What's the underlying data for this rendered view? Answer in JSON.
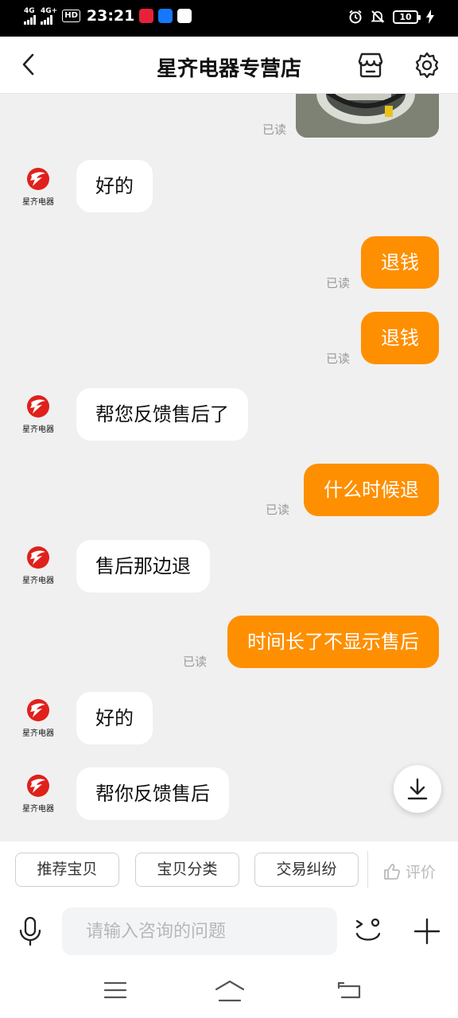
{
  "status_bar": {
    "signal1": "4G",
    "signal2": "4G+",
    "hd": "HD",
    "time": "23:21",
    "battery": "10"
  },
  "header": {
    "title": "星齐电器专营店"
  },
  "shop": {
    "avatar_label": "星齐电器"
  },
  "messages": {
    "read_label": "已读",
    "m1": "好的",
    "m2": "退钱",
    "m3": "退钱",
    "m4": "帮您反馈售后了",
    "m5": "什么时候退",
    "m6": "售后那边退",
    "m7": "时间长了不显示售后",
    "m8": "好的",
    "m9": "帮你反馈售后"
  },
  "quick_actions": {
    "recommend": "推荐宝贝",
    "category": "宝贝分类",
    "dispute": "交易纠纷",
    "rate": "评价"
  },
  "input": {
    "placeholder": "请输入咨询的问题"
  },
  "colors": {
    "accent": "#fe8f00",
    "logo": "#e0201b"
  }
}
